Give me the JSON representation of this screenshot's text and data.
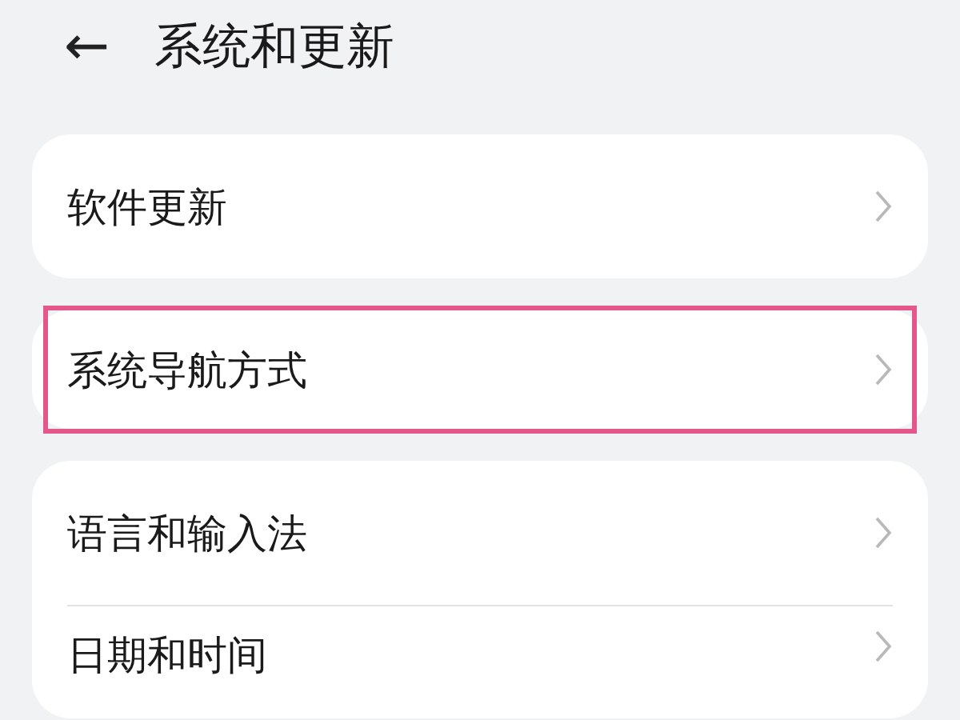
{
  "header": {
    "back": "←",
    "title": "系统和更新"
  },
  "groups": [
    {
      "items": [
        {
          "label": "软件更新",
          "highlighted": false
        }
      ]
    },
    {
      "items": [
        {
          "label": "系统导航方式",
          "highlighted": true
        }
      ]
    },
    {
      "items": [
        {
          "label": "语言和输入法",
          "highlighted": false
        },
        {
          "label": "日期和时间",
          "highlighted": false
        }
      ]
    }
  ]
}
